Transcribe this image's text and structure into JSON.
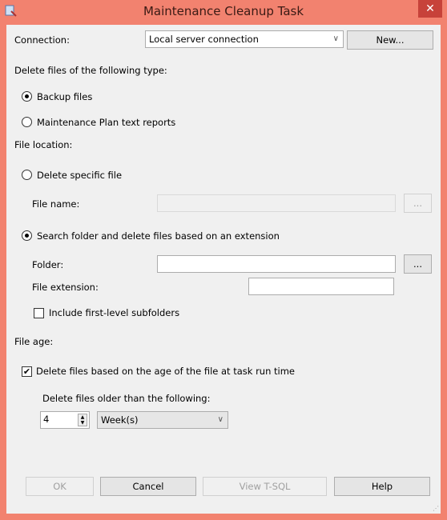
{
  "window": {
    "title": "Maintenance Cleanup Task",
    "close": "✕"
  },
  "connection": {
    "label": "Connection:",
    "value": "Local server connection",
    "new_button": "New..."
  },
  "file_type": {
    "heading": "Delete files of the following type:",
    "backup": "Backup files",
    "reports": "Maintenance Plan text reports",
    "selected": "backup"
  },
  "location": {
    "heading": "File location:",
    "specific": "Delete specific file",
    "file_name_label": "File name:",
    "file_name_value": "",
    "browse": "...",
    "search": "Search folder and delete files based on an extension",
    "folder_label": "Folder:",
    "folder_value": "",
    "extension_label": "File extension:",
    "extension_value": "",
    "subfolders": "Include first-level subfolders",
    "subfolders_checked": false,
    "selected": "search"
  },
  "age": {
    "heading": "File age:",
    "delete_by_age": "Delete files based on the age of the file at task run time",
    "delete_by_age_checked": true,
    "older_label": "Delete files older than the following:",
    "amount": "4",
    "unit": "Week(s)"
  },
  "footer": {
    "ok": "OK",
    "cancel": "Cancel",
    "view_tsql": "View T-SQL",
    "help": "Help"
  }
}
